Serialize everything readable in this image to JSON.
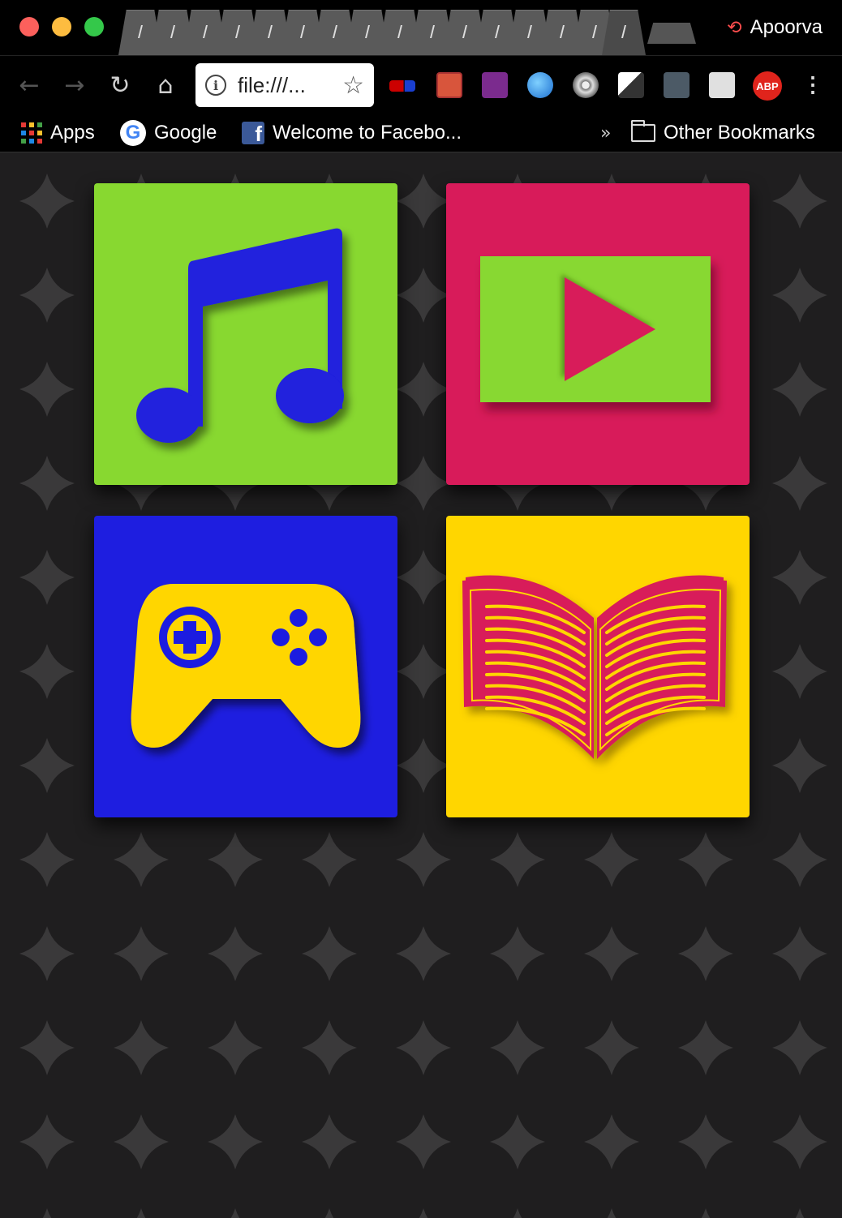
{
  "browser": {
    "profile_name": "Apoorva",
    "omnibox": {
      "url": "file:///..."
    },
    "extensions": [
      "extension-1",
      "extension-2",
      "extension-3",
      "extension-4",
      "extension-5",
      "extension-6",
      "extension-7",
      "extension-8"
    ],
    "adblock_label": "ABP"
  },
  "bookmarks": {
    "apps_label": "Apps",
    "google_label": "Google",
    "facebook_label": "Welcome to Facebo...",
    "overflow_label": "»",
    "other_label": "Other Bookmarks"
  },
  "tiles": [
    {
      "name": "music",
      "icon": "music-note-icon",
      "background": "#88d830",
      "icon_color": "#2020dd"
    },
    {
      "name": "video",
      "icon": "play-video-icon",
      "background": "#d81b5a",
      "icon_color": "#88d830"
    },
    {
      "name": "games",
      "icon": "gamepad-icon",
      "background": "#1e1ee0",
      "icon_color": "#ffd600"
    },
    {
      "name": "books",
      "icon": "open-book-icon",
      "background": "#ffd600",
      "icon_color": "#d81b5a"
    }
  ],
  "colors": {
    "page_background": "#1f1e1f",
    "sparkle": "#3a393a"
  }
}
